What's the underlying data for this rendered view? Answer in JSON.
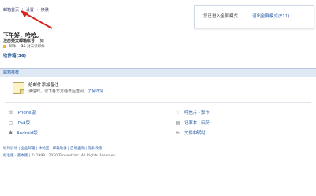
{
  "top_links": {
    "home": "邮箱首页",
    "sep": "|",
    "settings": "设置",
    "dash": "-",
    "skin": "换肤"
  },
  "fullscreen_banner": {
    "message": "您已进入全屏模式",
    "exit_label": "退出全屏模式(F11)"
  },
  "greeting": "下午好，哈哈。",
  "register": {
    "prefix": "注册英文邮箱帐号",
    "paren": "（如"
  },
  "mail_stat": {
    "label": "邮件：",
    "count": "36",
    "suffix": "封未读邮件"
  },
  "inbox_label": "收件箱(36)",
  "recommend_title": "邮箱推荐",
  "reminder": {
    "title": "给邮件添加备注",
    "desc": "读信时，记下备忘方便日后查阅。",
    "link": "了解详情"
  },
  "apps_left": [
    {
      "icon": "☏",
      "label": "iPhone版"
    },
    {
      "icon": "▢",
      "label": "iPad版"
    },
    {
      "icon": "✱",
      "label": "Android版"
    }
  ],
  "apps_right": [
    {
      "icon": "♡",
      "label": "明信片 · 贺卡"
    },
    {
      "icon": "▤",
      "label": "记事本 · 日历"
    },
    {
      "icon": "⇆",
      "label": "文件中转站"
    }
  ],
  "footer": {
    "links": "城幻引动 | 企业邮箱 | 体验室 | 邮箱助手 | 自助查询 | 隐私政策",
    "copy_links": "标准版 · 基本版",
    "copy_text": " | © 1998 - 2020 Tencent Inc. All Rights Reserved"
  },
  "colors": {
    "link": "#2d5fa8",
    "section_bg": "#dfe8f5",
    "arrow": "#d6261f"
  }
}
